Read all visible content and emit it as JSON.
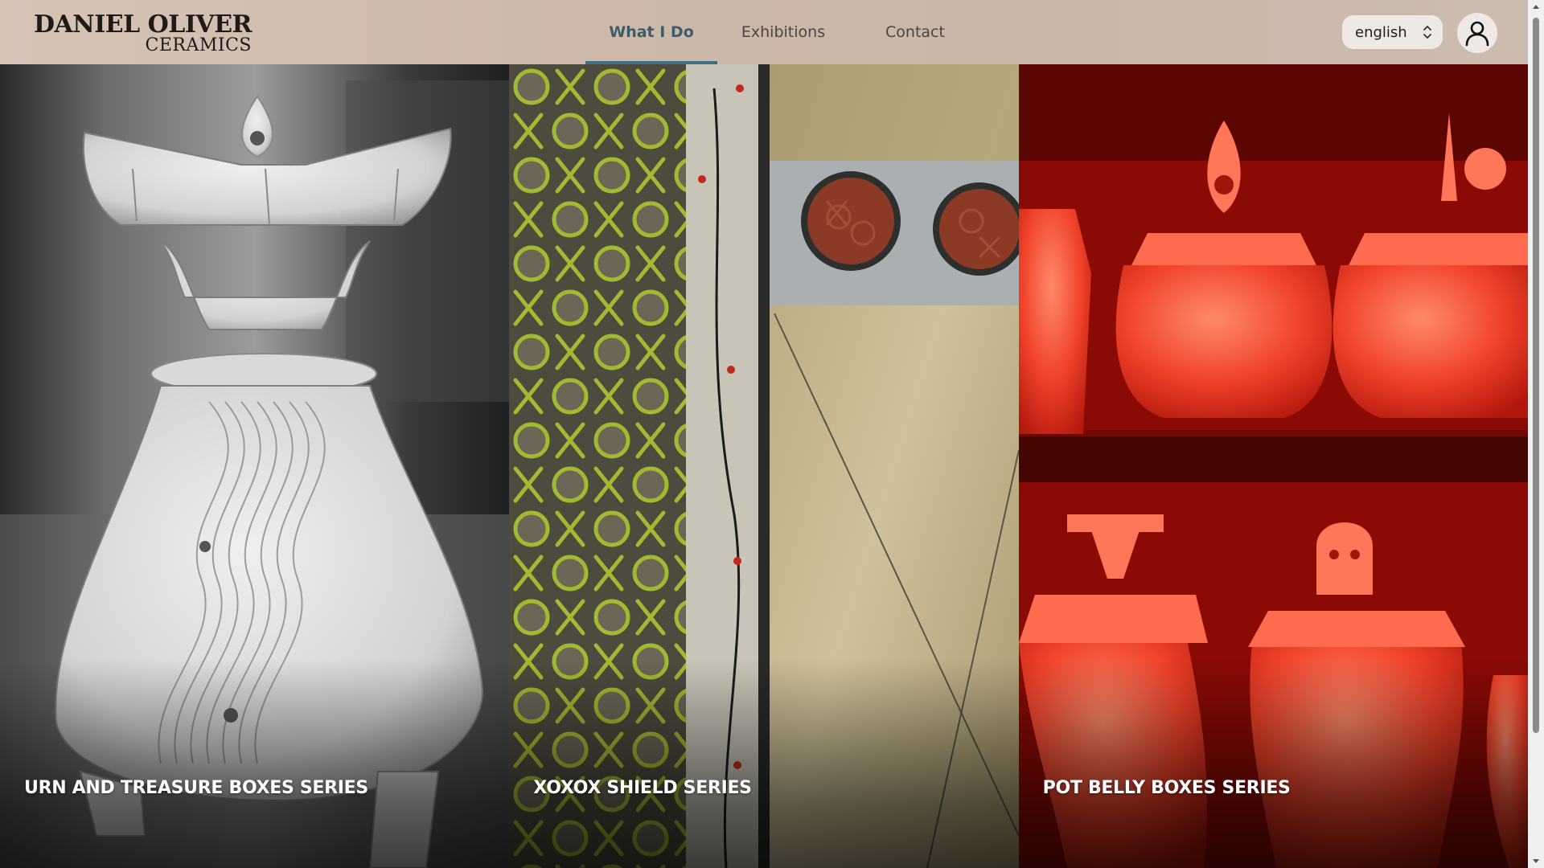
{
  "logo": {
    "line1": "DANIEL OLIVER",
    "line2": "CERAMICS"
  },
  "nav": {
    "items": [
      {
        "label": "What I Do",
        "active": true
      },
      {
        "label": "Exhibitions",
        "active": false
      },
      {
        "label": "Contact",
        "active": false
      }
    ]
  },
  "language": {
    "selected": "english"
  },
  "panels": [
    {
      "caption": "URN AND TREASURE BOXES SERIES",
      "icon": "urn-photo"
    },
    {
      "caption": "XOXOX SHIELD SERIES",
      "icon": "shield-photo"
    },
    {
      "caption": "POT BELLY BOXES SERIES",
      "icon": "pots-photo"
    }
  ],
  "colors": {
    "accent": "#3d6f80",
    "header_bg": "#cdb8aa",
    "nav_active": "#3d5d6b"
  }
}
